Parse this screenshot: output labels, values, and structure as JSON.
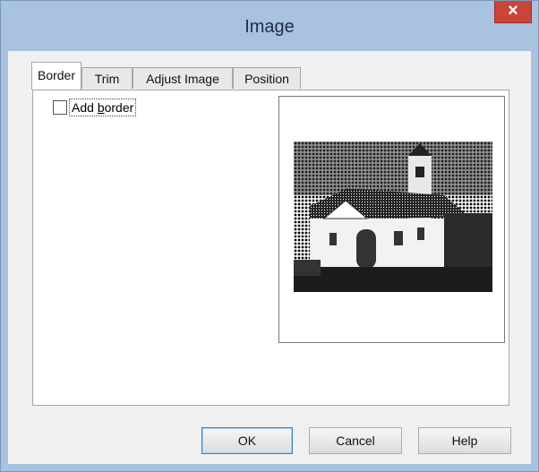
{
  "window": {
    "title": "Image",
    "close_glyph": "×"
  },
  "tabs": [
    {
      "label": "Border",
      "active": true
    },
    {
      "label": "Trim",
      "active": false
    },
    {
      "label": "Adjust Image",
      "active": false
    },
    {
      "label": "Position",
      "active": false
    }
  ],
  "border_tab": {
    "add_border": {
      "label": "Add border",
      "checked": false,
      "access_key": "b"
    }
  },
  "preview": {
    "icon": "church-photo-preview",
    "style": "black-and-white halftone"
  },
  "buttons": {
    "ok": "OK",
    "cancel": "Cancel",
    "help": "Help"
  },
  "colors": {
    "titlebar": "#a9c2e0",
    "close": "#c9453a",
    "dialog": "#f0f0f0"
  }
}
